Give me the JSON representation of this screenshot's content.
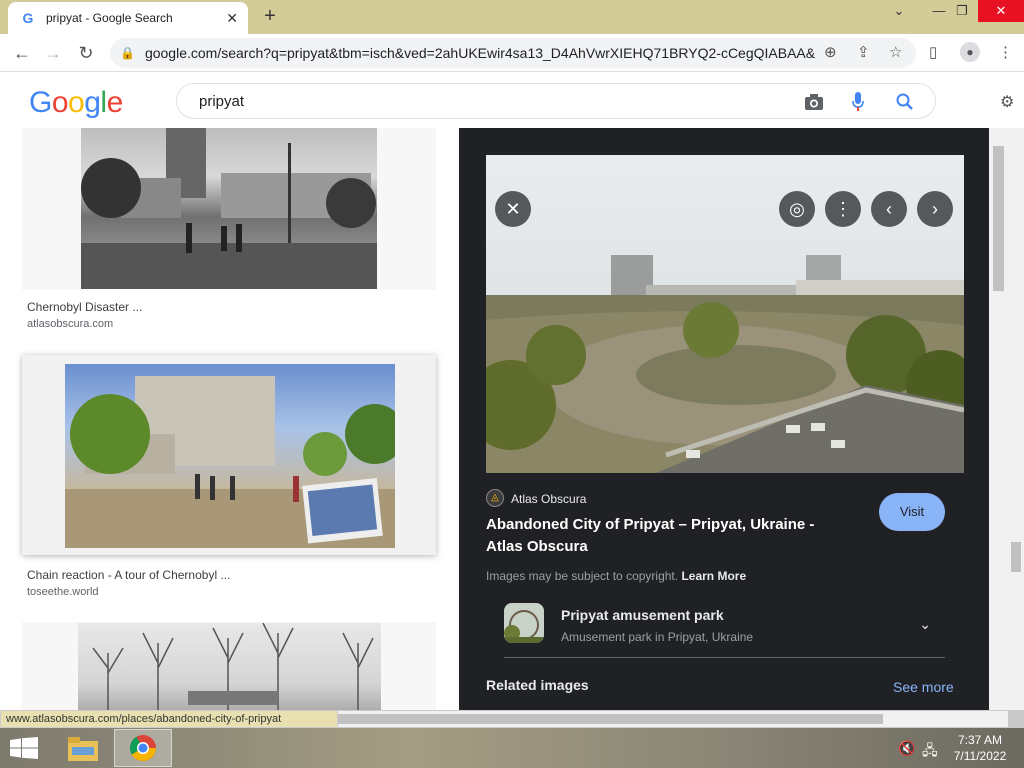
{
  "browser": {
    "tab_title": "pripyat - Google Search",
    "tab_favicon": "G",
    "url": "google.com/search?q=pripyat&tbm=isch&ved=2ahUKEwir4sa13_D4AhVwrXIEHQ71BRYQ2-cCegQIABAA&..."
  },
  "search": {
    "logo": "Google",
    "query": "pripyat"
  },
  "results": [
    {
      "title": "Chernobyl Disaster ...",
      "source": "atlasobscura.com"
    },
    {
      "title": "Chain reaction - A tour of Chernobyl ...",
      "source": "toseethe.world"
    }
  ],
  "preview": {
    "source_name": "Atlas Obscura",
    "title": "Abandoned City of Pripyat – Pripyat, Ukraine - Atlas Obscura",
    "visit_label": "Visit",
    "copyright_text": "Images may be subject to copyright.",
    "learn_more": "Learn More",
    "entity_name": "Pripyat amusement park",
    "entity_desc": "Amusement park in Pripyat, Ukraine",
    "related_label": "Related images",
    "see_more": "See more"
  },
  "status_url": "www.atlasobscura.com/places/abandoned-city-of-pripyat",
  "taskbar": {
    "time": "7:37 AM",
    "date": "7/11/2022"
  },
  "colors": {
    "tabbar": "#d4cc98",
    "panel_bg": "#202124",
    "accent_blue": "#8ab4f8",
    "close_red": "#e81123"
  },
  "icons": [
    "google-favicon-icon",
    "close-tab-icon",
    "new-tab-icon",
    "minimize-icon",
    "restore-icon",
    "close-window-icon",
    "back-icon",
    "forward-icon",
    "reload-icon",
    "lock-icon",
    "zoom-icon",
    "share-icon",
    "star-icon",
    "sidebar-icon",
    "profile-icon",
    "menu-icon",
    "camera-icon",
    "mic-icon",
    "search-icon",
    "close-preview-icon",
    "lens-icon",
    "more-icon",
    "prev-icon",
    "next-icon",
    "atlas-obscura-icon",
    "chevron-down-icon",
    "windows-start-icon",
    "file-explorer-icon",
    "chrome-icon",
    "volume-muted-icon",
    "network-icon"
  ]
}
